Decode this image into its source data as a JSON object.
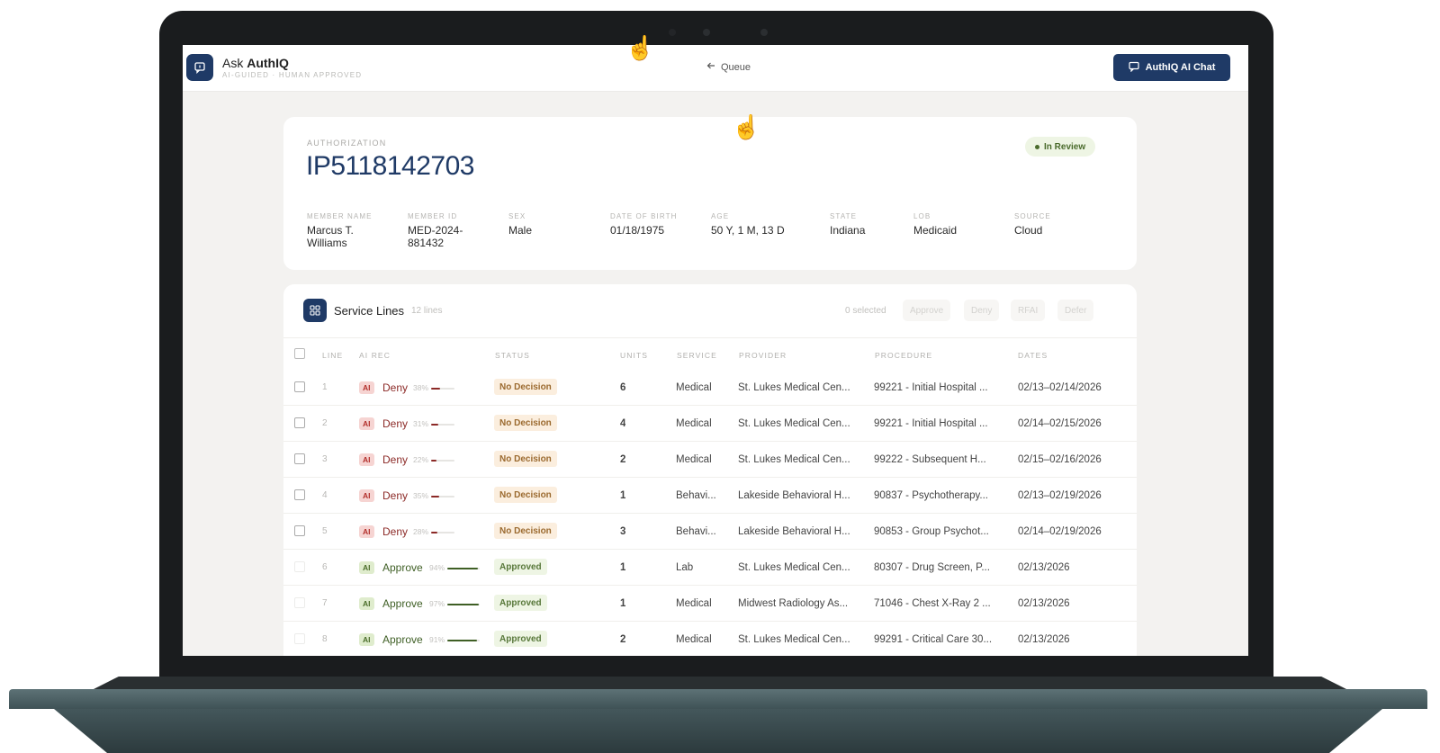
{
  "header": {
    "brand_prefix": "Ask",
    "brand_name": "AuthIQ",
    "brand_subtitle": "AI-GUIDED · HUMAN APPROVED",
    "queue_label": "Queue",
    "chat_button": "AuthIQ AI Chat"
  },
  "authorization": {
    "label": "AUTHORIZATION",
    "id": "IP5118142703",
    "status": "In Review",
    "fields": [
      {
        "label": "MEMBER NAME",
        "value": "Marcus T. Williams"
      },
      {
        "label": "MEMBER ID",
        "value": "MED-2024-881432"
      },
      {
        "label": "SEX",
        "value": "Male"
      },
      {
        "label": "DATE OF BIRTH",
        "value": "01/18/1975"
      },
      {
        "label": "AGE",
        "value": "50 Y, 1 M, 13 D"
      },
      {
        "label": "STATE",
        "value": "Indiana"
      },
      {
        "label": "LOB",
        "value": "Medicaid"
      },
      {
        "label": "SOURCE",
        "value": "Cloud"
      }
    ]
  },
  "service_lines": {
    "title": "Service Lines",
    "count": "12 lines",
    "selected": "0 selected",
    "actions": [
      "Approve",
      "Deny",
      "RFAI",
      "Defer"
    ],
    "columns": [
      "LINE",
      "AI REC",
      "STATUS",
      "UNITS",
      "SERVICE",
      "PROVIDER",
      "PROCEDURE",
      "DATES"
    ],
    "rows": [
      {
        "line": "1",
        "ai_tag": "AI",
        "rec": "Deny",
        "pct": "38%",
        "confidence": 0.38,
        "status": "No Decision",
        "units": "6",
        "service": "Medical",
        "provider": "St. Lukes Medical Cen...",
        "procedure": "99221 - Initial Hospital ...",
        "dates": "02/13–02/14/2026"
      },
      {
        "line": "2",
        "ai_tag": "AI",
        "rec": "Deny",
        "pct": "31%",
        "confidence": 0.31,
        "status": "No Decision",
        "units": "4",
        "service": "Medical",
        "provider": "St. Lukes Medical Cen...",
        "procedure": "99221 - Initial Hospital ...",
        "dates": "02/14–02/15/2026"
      },
      {
        "line": "3",
        "ai_tag": "AI",
        "rec": "Deny",
        "pct": "22%",
        "confidence": 0.22,
        "status": "No Decision",
        "units": "2",
        "service": "Medical",
        "provider": "St. Lukes Medical Cen...",
        "procedure": "99222 - Subsequent H...",
        "dates": "02/15–02/16/2026"
      },
      {
        "line": "4",
        "ai_tag": "AI",
        "rec": "Deny",
        "pct": "35%",
        "confidence": 0.35,
        "status": "No Decision",
        "units": "1",
        "service": "Behavi...",
        "provider": "Lakeside Behavioral H...",
        "procedure": "90837 - Psychotherapy...",
        "dates": "02/13–02/19/2026"
      },
      {
        "line": "5",
        "ai_tag": "AI",
        "rec": "Deny",
        "pct": "28%",
        "confidence": 0.28,
        "status": "No Decision",
        "units": "3",
        "service": "Behavi...",
        "provider": "Lakeside Behavioral H...",
        "procedure": "90853 - Group Psychot...",
        "dates": "02/14–02/19/2026"
      },
      {
        "line": "6",
        "ai_tag": "AI",
        "rec": "Approve",
        "pct": "94%",
        "confidence": 0.94,
        "status": "Approved",
        "units": "1",
        "service": "Lab",
        "provider": "St. Lukes Medical Cen...",
        "procedure": "80307 - Drug Screen, P...",
        "dates": "02/13/2026"
      },
      {
        "line": "7",
        "ai_tag": "AI",
        "rec": "Approve",
        "pct": "97%",
        "confidence": 0.97,
        "status": "Approved",
        "units": "1",
        "service": "Medical",
        "provider": "Midwest Radiology As...",
        "procedure": "71046 - Chest X-Ray 2 ...",
        "dates": "02/13/2026"
      },
      {
        "line": "8",
        "ai_tag": "AI",
        "rec": "Approve",
        "pct": "91%",
        "confidence": 0.91,
        "status": "Approved",
        "units": "2",
        "service": "Medical",
        "provider": "St. Lukes Medical Cen...",
        "procedure": "99291 - Critical Care 30...",
        "dates": "02/13/2026"
      }
    ]
  },
  "colors": {
    "brand": "#1f3a66",
    "deny": "#8c2a27",
    "approve": "#3f5f25",
    "no_decision_bg": "#fbeede",
    "approved_bg": "#eef5e4"
  }
}
